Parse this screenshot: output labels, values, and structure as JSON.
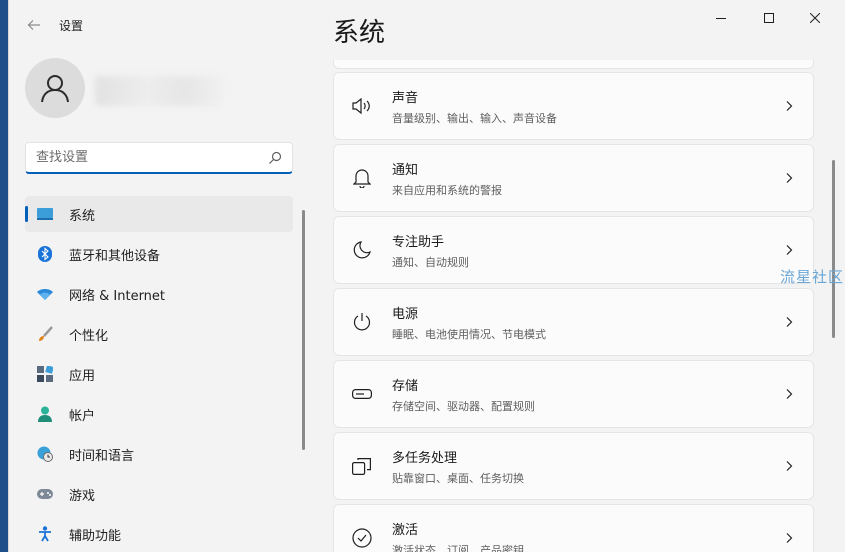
{
  "app": {
    "title": "设置"
  },
  "search": {
    "placeholder": "查找设置"
  },
  "nav": {
    "items": [
      {
        "label": "系统"
      },
      {
        "label": "蓝牙和其他设备"
      },
      {
        "label": "网络 & Internet"
      },
      {
        "label": "个性化"
      },
      {
        "label": "应用"
      },
      {
        "label": "帐户"
      },
      {
        "label": "时间和语言"
      },
      {
        "label": "游戏"
      },
      {
        "label": "辅助功能"
      }
    ]
  },
  "page": {
    "title": "系统"
  },
  "cards": [
    {
      "title": "声音",
      "subtitle": "音量级别、输出、输入、声音设备",
      "icon": "speaker-icon"
    },
    {
      "title": "通知",
      "subtitle": "来自应用和系统的警报",
      "icon": "bell-icon"
    },
    {
      "title": "专注助手",
      "subtitle": "通知、自动规则",
      "icon": "moon-icon"
    },
    {
      "title": "电源",
      "subtitle": "睡眠、电池使用情况、节电模式",
      "icon": "power-icon"
    },
    {
      "title": "存储",
      "subtitle": "存储空间、驱动器、配置规则",
      "icon": "storage-icon"
    },
    {
      "title": "多任务处理",
      "subtitle": "贴靠窗口、桌面、任务切换",
      "icon": "multitask-icon"
    },
    {
      "title": "激活",
      "subtitle": "激活状态、订阅、产品密钥",
      "icon": "check-circle-icon"
    }
  ],
  "watermark": "流星社区",
  "colors": {
    "accent": "#005fb8",
    "background": "#f3f3f3",
    "card": "#fbfbfb"
  }
}
